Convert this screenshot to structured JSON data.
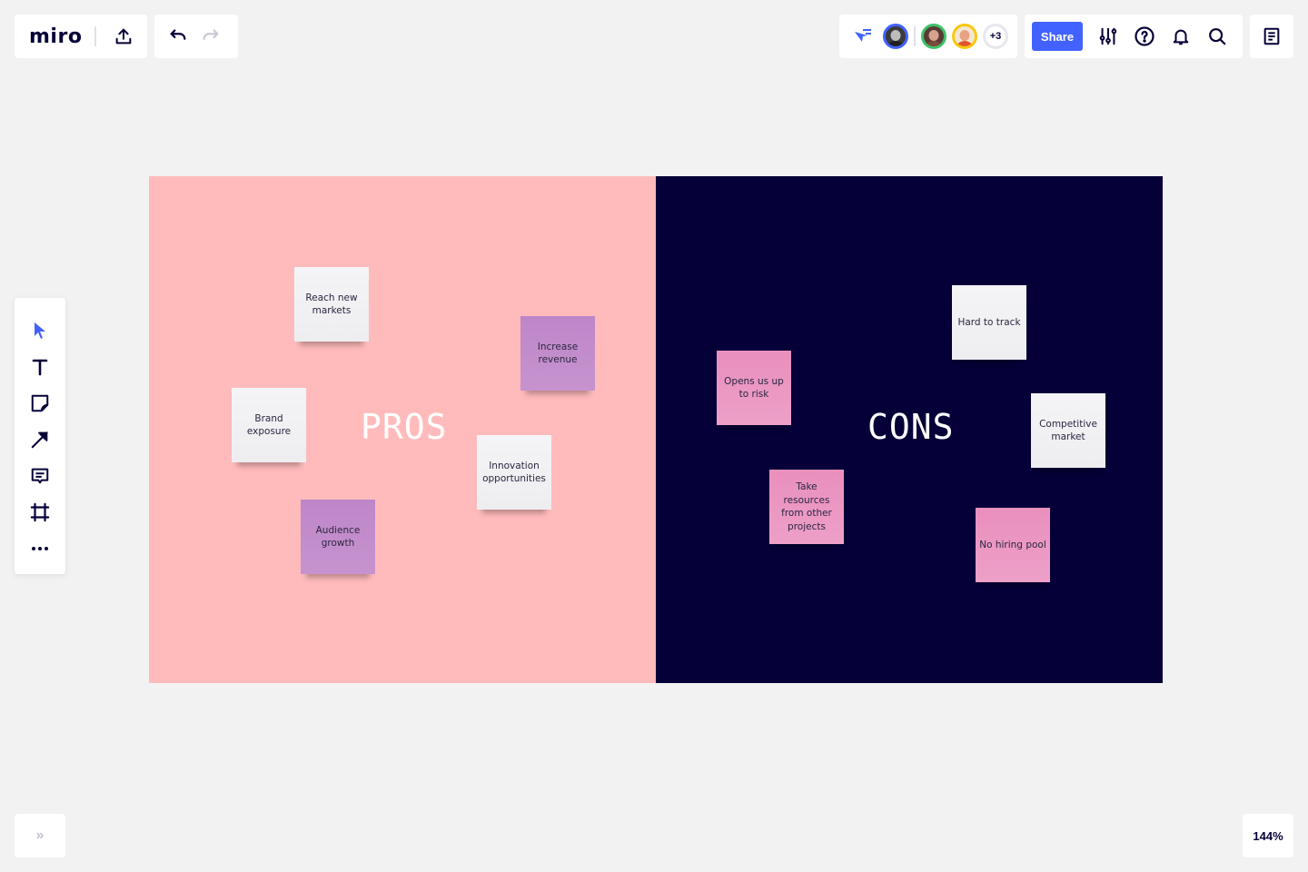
{
  "app": {
    "logo_text": "miro"
  },
  "toolbar_top_left": {
    "upload_icon": "upload-icon",
    "undo_icon": "undo-icon",
    "redo_icon": "redo-icon"
  },
  "collaboration": {
    "cursor_icon": "cursor-follow-icon",
    "users": [
      {
        "name": "user-1",
        "ring_color": "#4262ff"
      },
      {
        "name": "user-2",
        "ring_color": "#3fc169"
      },
      {
        "name": "user-3",
        "ring_color": "#fac710"
      }
    ],
    "more_users_label": "+3"
  },
  "toolbar_top_right": {
    "share_label": "Share",
    "icons": [
      "settings-sliders-icon",
      "help-icon",
      "bell-icon",
      "search-icon"
    ],
    "notes_icon": "notes-icon"
  },
  "left_toolbar": {
    "tools": [
      "select-tool",
      "text-tool",
      "sticky-note-tool",
      "connector-tool",
      "comment-tool",
      "frame-tool",
      "more-tools"
    ],
    "active_color": "#4262ff"
  },
  "bottom": {
    "expand_label": "»",
    "zoom_level": "144%"
  },
  "board": {
    "pros": {
      "title": "PROS",
      "background": "#ffbbbb",
      "stickies": [
        {
          "text": "Reach new markets",
          "color": "white"
        },
        {
          "text": "Increase revenue",
          "color": "purple"
        },
        {
          "text": "Brand exposure",
          "color": "white"
        },
        {
          "text": "Innovation opportunities",
          "color": "white"
        },
        {
          "text": "Audience growth",
          "color": "purple"
        }
      ]
    },
    "cons": {
      "title": "CONS",
      "background": "#050038",
      "stickies": [
        {
          "text": "Hard to track",
          "color": "white"
        },
        {
          "text": "Opens us up to risk",
          "color": "pink"
        },
        {
          "text": "Competitive market",
          "color": "white"
        },
        {
          "text": "Take resources from other projects",
          "color": "pink"
        },
        {
          "text": "No hiring pool",
          "color": "pink"
        }
      ]
    }
  }
}
